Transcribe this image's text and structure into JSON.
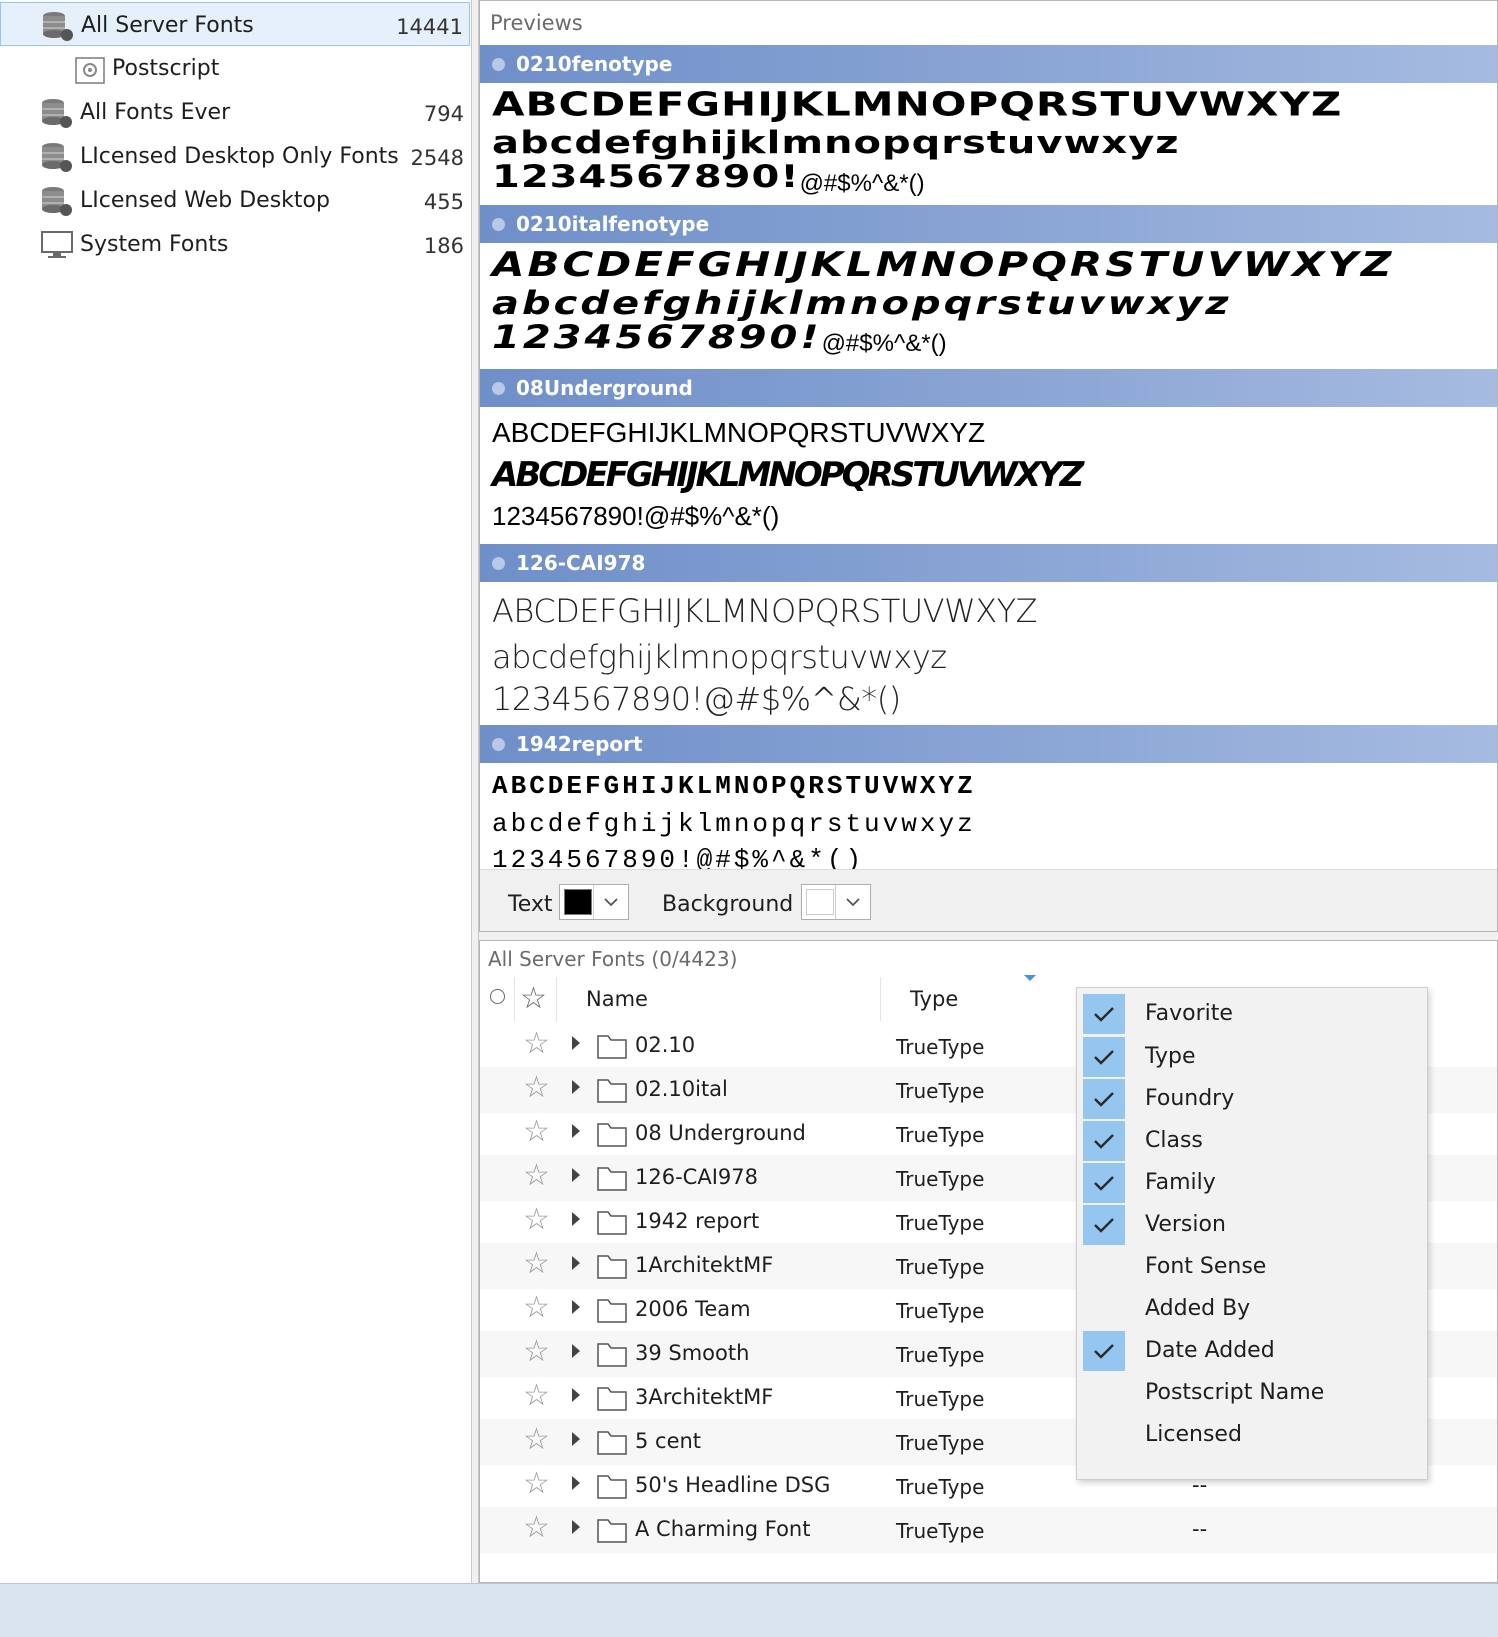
{
  "library": {
    "items": [
      {
        "label": "All Server Fonts",
        "count": "14441",
        "icon": "database-icon",
        "selected": true
      },
      {
        "label": "Postscript",
        "count": "",
        "icon": "gear-folder-icon",
        "sub": true
      },
      {
        "label": "All Fonts Ever",
        "count": "794",
        "icon": "database-icon"
      },
      {
        "label": "LIcensed Desktop Only Fonts",
        "count": "2548",
        "icon": "database-icon"
      },
      {
        "label": "LIcensed Web  Desktop",
        "count": "455",
        "icon": "database-icon"
      },
      {
        "label": "System Fonts",
        "count": "186",
        "icon": "monitor-icon"
      }
    ]
  },
  "previews": {
    "title": "Previews",
    "fonts": [
      {
        "name": "0210fenotype",
        "upper": "ABCDEFGHIJKLMNOPQRSTUVWXYZ",
        "lower": "abcdefghijklmnopqrstuvwxyz",
        "digits": "1234567890!",
        "tail": "@#$%^&*()"
      },
      {
        "name": "0210italfenotype",
        "upper": "ABCDEFGHIJKLMNOPQRSTUVWXYZ",
        "lower": "abcdefghijklmnopqrstuvwxyz",
        "digits": "1234567890!",
        "tail": "@#$%^&*()"
      },
      {
        "name": "08Underground",
        "upper": "ABCDEFGHIJKLMNOPQRSTUVWXYZ",
        "lower": "ABCDEFGHIJKLMNOPQRSTUVWXYZ",
        "digits": "1234567890!",
        "tail": "@#$%^&*()"
      },
      {
        "name": "126-CAI978",
        "upper": "ABCDEFGHIJKLMNOPQRSTUVWXYZ",
        "lower": "abcdefghijklmnopqrstuvwxyz",
        "digits": "1234567890!@#$%^&*()"
      },
      {
        "name": "1942report",
        "upper": "ABCDEFGHIJKLMNOPQRSTUVWXYZ",
        "lower": "abcdefghijklmnopqrstuvwxyz",
        "digits": "1234567890!@#$%^&*()"
      }
    ],
    "text_color_label": "Text",
    "text_color": "#000000",
    "background_label": "Background",
    "background_color": "#ffffff"
  },
  "list": {
    "header": "All Server Fonts (0/4423)",
    "columns": {
      "name": "Name",
      "type": "Type"
    },
    "rows": [
      {
        "name": "02.10",
        "type": "TrueType"
      },
      {
        "name": "02.10ital",
        "type": "TrueType"
      },
      {
        "name": "08 Underground",
        "type": "TrueType"
      },
      {
        "name": "126-CAI978",
        "type": "TrueType"
      },
      {
        "name": "1942 report",
        "type": "TrueType"
      },
      {
        "name": "1ArchitektMF",
        "type": "TrueType"
      },
      {
        "name": "2006 Team",
        "type": "TrueType"
      },
      {
        "name": "39 Smooth",
        "type": "TrueType"
      },
      {
        "name": "3ArchitektMF",
        "type": "TrueType"
      },
      {
        "name": "5 cent",
        "type": "TrueType"
      },
      {
        "name": "50's Headline DSG",
        "type": "TrueType",
        "extra": "--"
      },
      {
        "name": "A Charming Font",
        "type": "TrueType",
        "extra": "--"
      }
    ]
  },
  "column_menu": {
    "items": [
      {
        "label": "Favorite",
        "checked": true
      },
      {
        "label": "Type",
        "checked": true
      },
      {
        "label": "Foundry",
        "checked": true
      },
      {
        "label": "Class",
        "checked": true
      },
      {
        "label": "Family",
        "checked": true
      },
      {
        "label": "Version",
        "checked": true
      },
      {
        "label": "Font Sense",
        "checked": false
      },
      {
        "label": "Added By",
        "checked": false
      },
      {
        "label": "Date Added",
        "checked": true
      },
      {
        "label": "Postscript Name",
        "checked": false
      },
      {
        "label": "Licensed",
        "checked": false
      }
    ]
  },
  "colors": {
    "accent": "#95c6f0",
    "bar": "#7f9dd0",
    "selection": "#e5f0fb"
  }
}
